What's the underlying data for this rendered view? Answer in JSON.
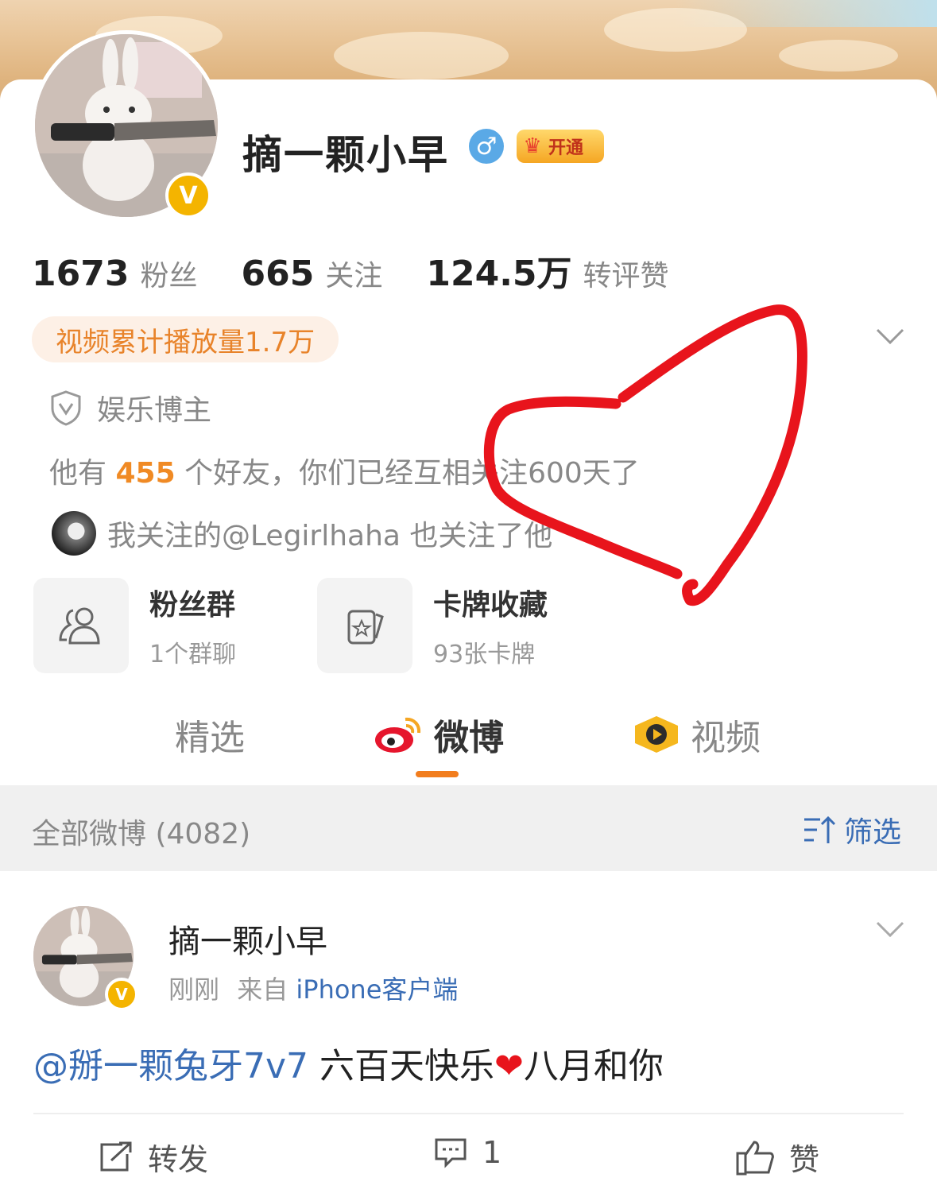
{
  "profile": {
    "name": "摘一颗小早",
    "gender_symbol": "♂",
    "vip_label": "开通",
    "verified_badge": "V",
    "stats": [
      {
        "value": "1673",
        "label": "粉丝"
      },
      {
        "value": "665",
        "label": "关注"
      },
      {
        "value": "124.5万",
        "label": "转评赞"
      }
    ],
    "video_plays": "视频累计播放量1.7万",
    "tag_label": "娱乐博主",
    "friends": {
      "pre": "他有",
      "count": "455",
      "post": "个好友，你们已经互相关注600天了"
    },
    "mutual_follow": "我关注的@Legirlhaha 也关注了他",
    "tiles": [
      {
        "title": "粉丝群",
        "sub": "1个群聊"
      },
      {
        "title": "卡牌收藏",
        "sub": "93张卡牌"
      }
    ]
  },
  "tabs": [
    {
      "label": "精选"
    },
    {
      "label": "微博"
    },
    {
      "label": "视频"
    }
  ],
  "filter": {
    "all_label": "全部微博 (4082)",
    "filter_label": "筛选"
  },
  "post": {
    "author": "摘一颗小早",
    "time": "刚刚",
    "from": "来自",
    "source": "iPhone客户端",
    "mention": "@掰一颗兔牙7v7",
    "text": " 六百天快乐",
    "heart": "❤",
    "text2": "八月和你",
    "actions": {
      "repost": "转发",
      "comment": "1",
      "like": "赞"
    }
  },
  "colors": {
    "accent": "#f27d1d",
    "link": "#3a6db5",
    "scribble": "#e8141c"
  }
}
